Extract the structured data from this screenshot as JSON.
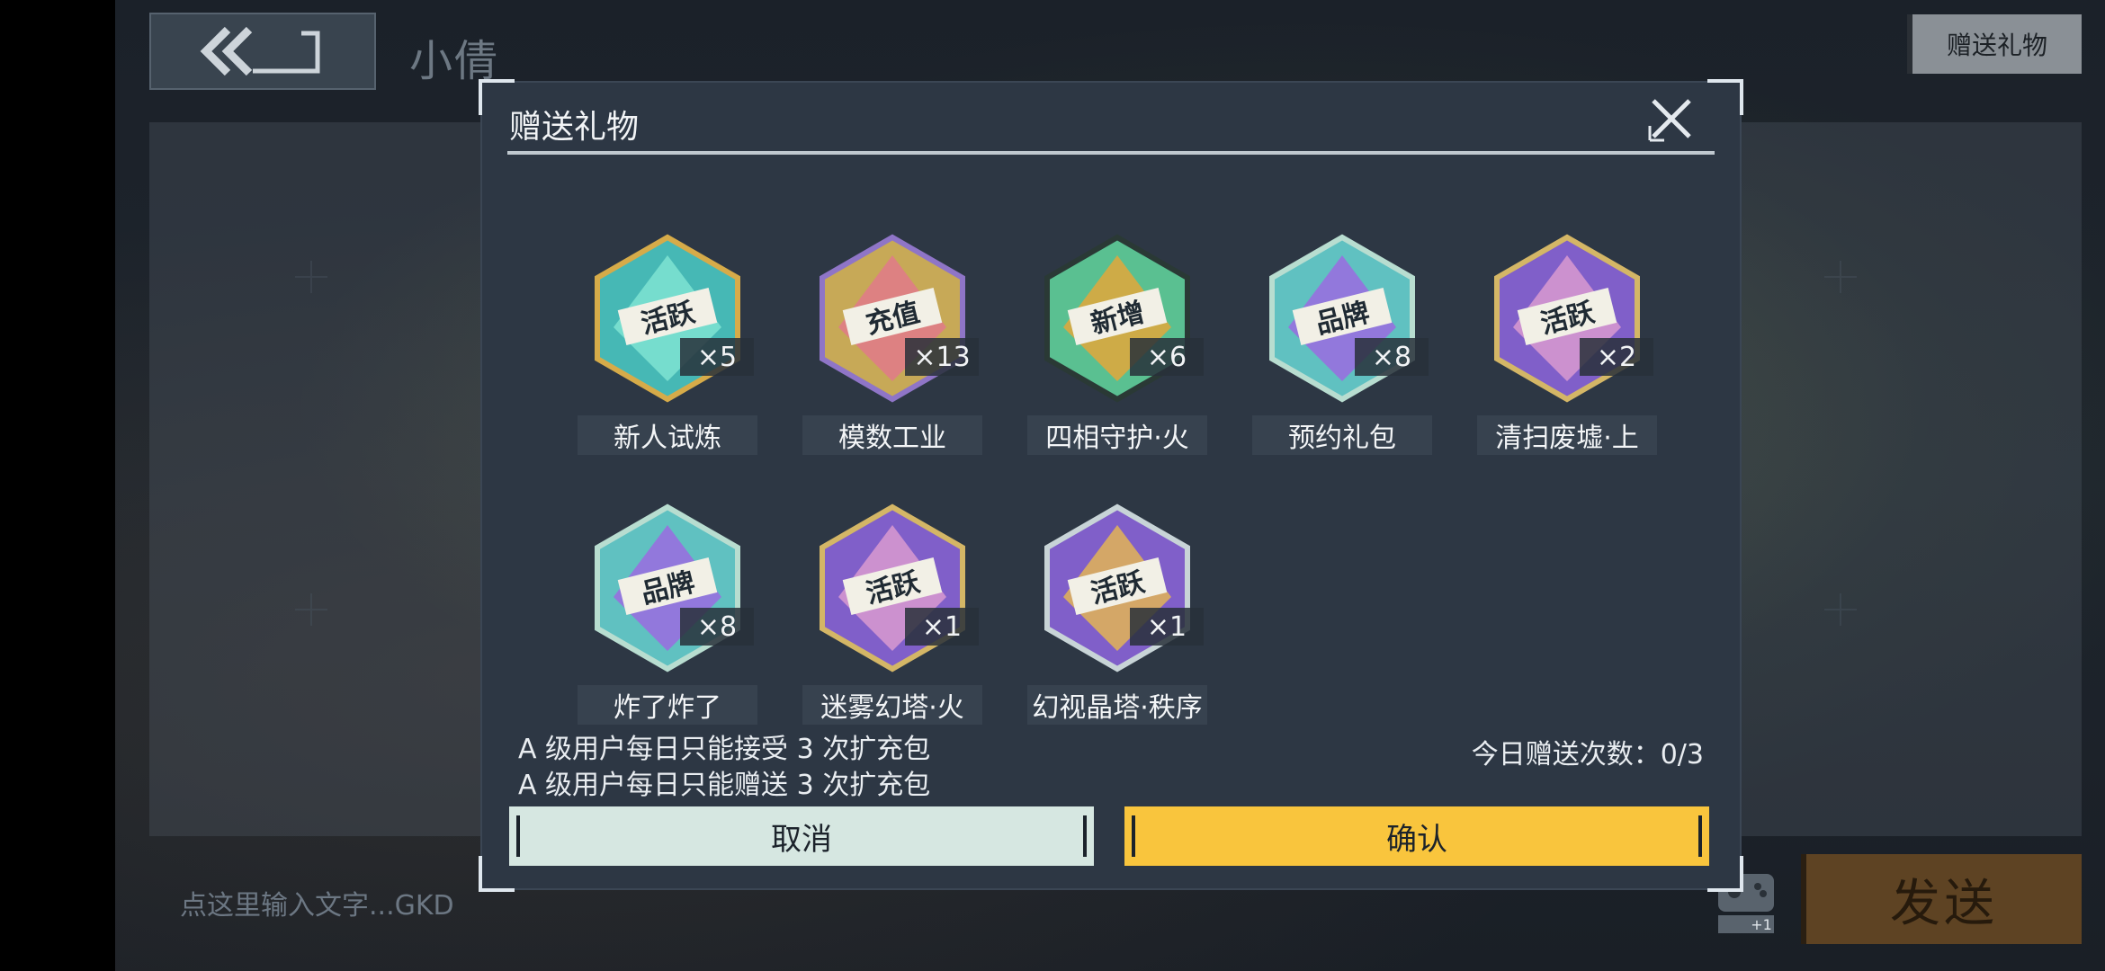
{
  "header": {
    "chat_name": "小倩",
    "gift_button_label": "赠送礼物"
  },
  "input": {
    "placeholder": "点这里输入文字...GKD",
    "send_label": "发送",
    "gamepad_badge": "+1"
  },
  "modal": {
    "title": "赠送礼物",
    "gifts": [
      {
        "name": "新人试炼",
        "count": "×5",
        "icon": "active-badge-icon",
        "badge_text": "活跃",
        "colors": [
          "#49c7c2",
          "#7fe3d2",
          "#e9b84a"
        ]
      },
      {
        "name": "模数工业",
        "count": "×13",
        "icon": "recharge-crystal-icon",
        "badge_text": "充值",
        "colors": [
          "#d8b65a",
          "#e07a8a",
          "#9a7cd6"
        ]
      },
      {
        "name": "四相守护·火",
        "count": "×6",
        "icon": "new-crystal-icon",
        "badge_text": "新增",
        "colors": [
          "#5fcf9a",
          "#e3a73a",
          "#2a3a34"
        ]
      },
      {
        "name": "预约礼包",
        "count": "×8",
        "icon": "brand-pyramid-icon",
        "badge_text": "品牌",
        "colors": [
          "#66d1cf",
          "#9b6be0",
          "#c8efe0"
        ]
      },
      {
        "name": "清扫废墟·上",
        "count": "×2",
        "icon": "active-crystal-icon",
        "badge_text": "活跃",
        "colors": [
          "#8a64d8",
          "#d99ad0",
          "#e7c46a"
        ]
      },
      {
        "name": "炸了炸了",
        "count": "×8",
        "icon": "brand-pyramid-icon",
        "badge_text": "品牌",
        "colors": [
          "#66d1cf",
          "#9b6be0",
          "#c8efe0"
        ]
      },
      {
        "name": "迷雾幻塔·火",
        "count": "×1",
        "icon": "active-crystal-icon",
        "badge_text": "活跃",
        "colors": [
          "#8a64d8",
          "#d99ad0",
          "#e7c46a"
        ]
      },
      {
        "name": "幻视晶塔·秩序",
        "count": "×1",
        "icon": "active-crystal-gold-icon",
        "badge_text": "活跃",
        "colors": [
          "#8a64d8",
          "#e3b456",
          "#d9e6e8"
        ]
      }
    ],
    "notice_receive": "A 级用户每日只能接受 3 次扩充包",
    "notice_send": "A 级用户每日只能赠送 3 次扩充包",
    "daily_count": "今日赠送次数：0/3",
    "cancel_label": "取消",
    "confirm_label": "确认"
  }
}
